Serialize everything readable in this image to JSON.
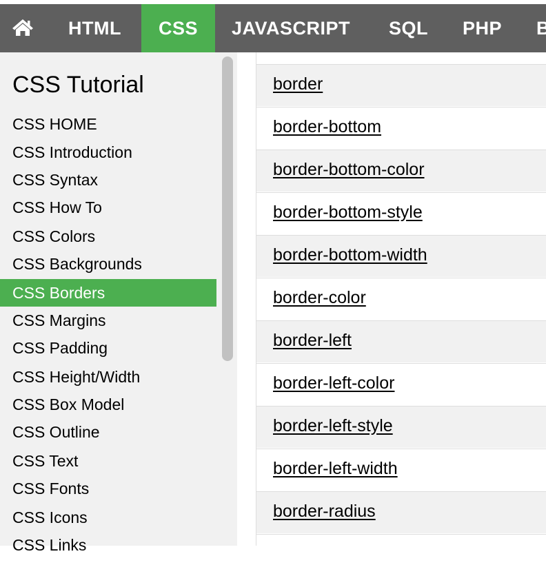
{
  "topnav": {
    "home_icon": "home-icon",
    "items": [
      {
        "label": "HTML"
      },
      {
        "label": "CSS",
        "active": true
      },
      {
        "label": "JAVASCRIPT"
      },
      {
        "label": "SQL"
      },
      {
        "label": "PHP"
      },
      {
        "label": "B"
      }
    ],
    "colors": {
      "bar": "#5f5f5f",
      "active": "#4caf50",
      "text": "#ffffff"
    }
  },
  "sidebar": {
    "title": "CSS Tutorial",
    "items": [
      {
        "label": "CSS HOME"
      },
      {
        "label": "CSS Introduction"
      },
      {
        "label": "CSS Syntax"
      },
      {
        "label": "CSS How To"
      },
      {
        "label": "CSS Colors"
      },
      {
        "label": "CSS Backgrounds"
      },
      {
        "label": "CSS Borders",
        "active": true
      },
      {
        "label": "CSS Margins"
      },
      {
        "label": "CSS Padding"
      },
      {
        "label": "CSS Height/Width"
      },
      {
        "label": "CSS Box Model"
      },
      {
        "label": "CSS Outline"
      },
      {
        "label": "CSS Text"
      },
      {
        "label": "CSS Fonts"
      },
      {
        "label": "CSS Icons"
      },
      {
        "label": "CSS Links"
      }
    ],
    "colors": {
      "background": "#f1f1f1",
      "active": "#4caf50"
    }
  },
  "properties": [
    {
      "label": "border"
    },
    {
      "label": "border-bottom"
    },
    {
      "label": "border-bottom-color"
    },
    {
      "label": "border-bottom-style"
    },
    {
      "label": "border-bottom-width"
    },
    {
      "label": "border-color"
    },
    {
      "label": "border-left"
    },
    {
      "label": "border-left-color"
    },
    {
      "label": "border-left-style"
    },
    {
      "label": "border-left-width"
    },
    {
      "label": "border-radius"
    }
  ]
}
